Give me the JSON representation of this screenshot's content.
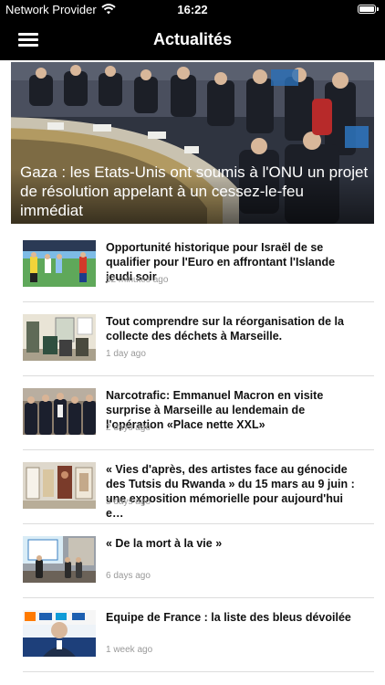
{
  "status_bar": {
    "carrier": "Network Provider",
    "time": "16:22"
  },
  "nav": {
    "title": "Actualités",
    "menu_icon": "hamburger-menu-icon"
  },
  "hero": {
    "caption": "Gaza : les Etats-Unis ont soumis à l'ONU un projet de résolution appelant à un cessez-le-feu immédiat"
  },
  "articles": [
    {
      "title": "Opportunité historique pour Israël de se qualifier pour l'Euro en affrontant l'Islande jeudi soir",
      "time": "52 minutes ago"
    },
    {
      "title": "Tout comprendre sur la réorganisation de la collecte des déchets à Marseille.",
      "time": "1 day ago"
    },
    {
      "title": "Narcotrafic: Emmanuel Macron en visite surprise à Marseille au lendemain de l'opération «Place nette XXL»",
      "time": "2 days ago"
    },
    {
      "title": "« Vies d'après, des artistes face au génocide des Tutsis du Rwanda » du 15 mars au 9 juin : une exposition mémorielle pour aujourd'hui e…",
      "time": "3 days ago"
    },
    {
      "title": "« De la mort à la vie »",
      "time": "6 days ago"
    },
    {
      "title": "Equipe de France : la liste des bleus dévoilée",
      "time": "1 week ago"
    }
  ]
}
